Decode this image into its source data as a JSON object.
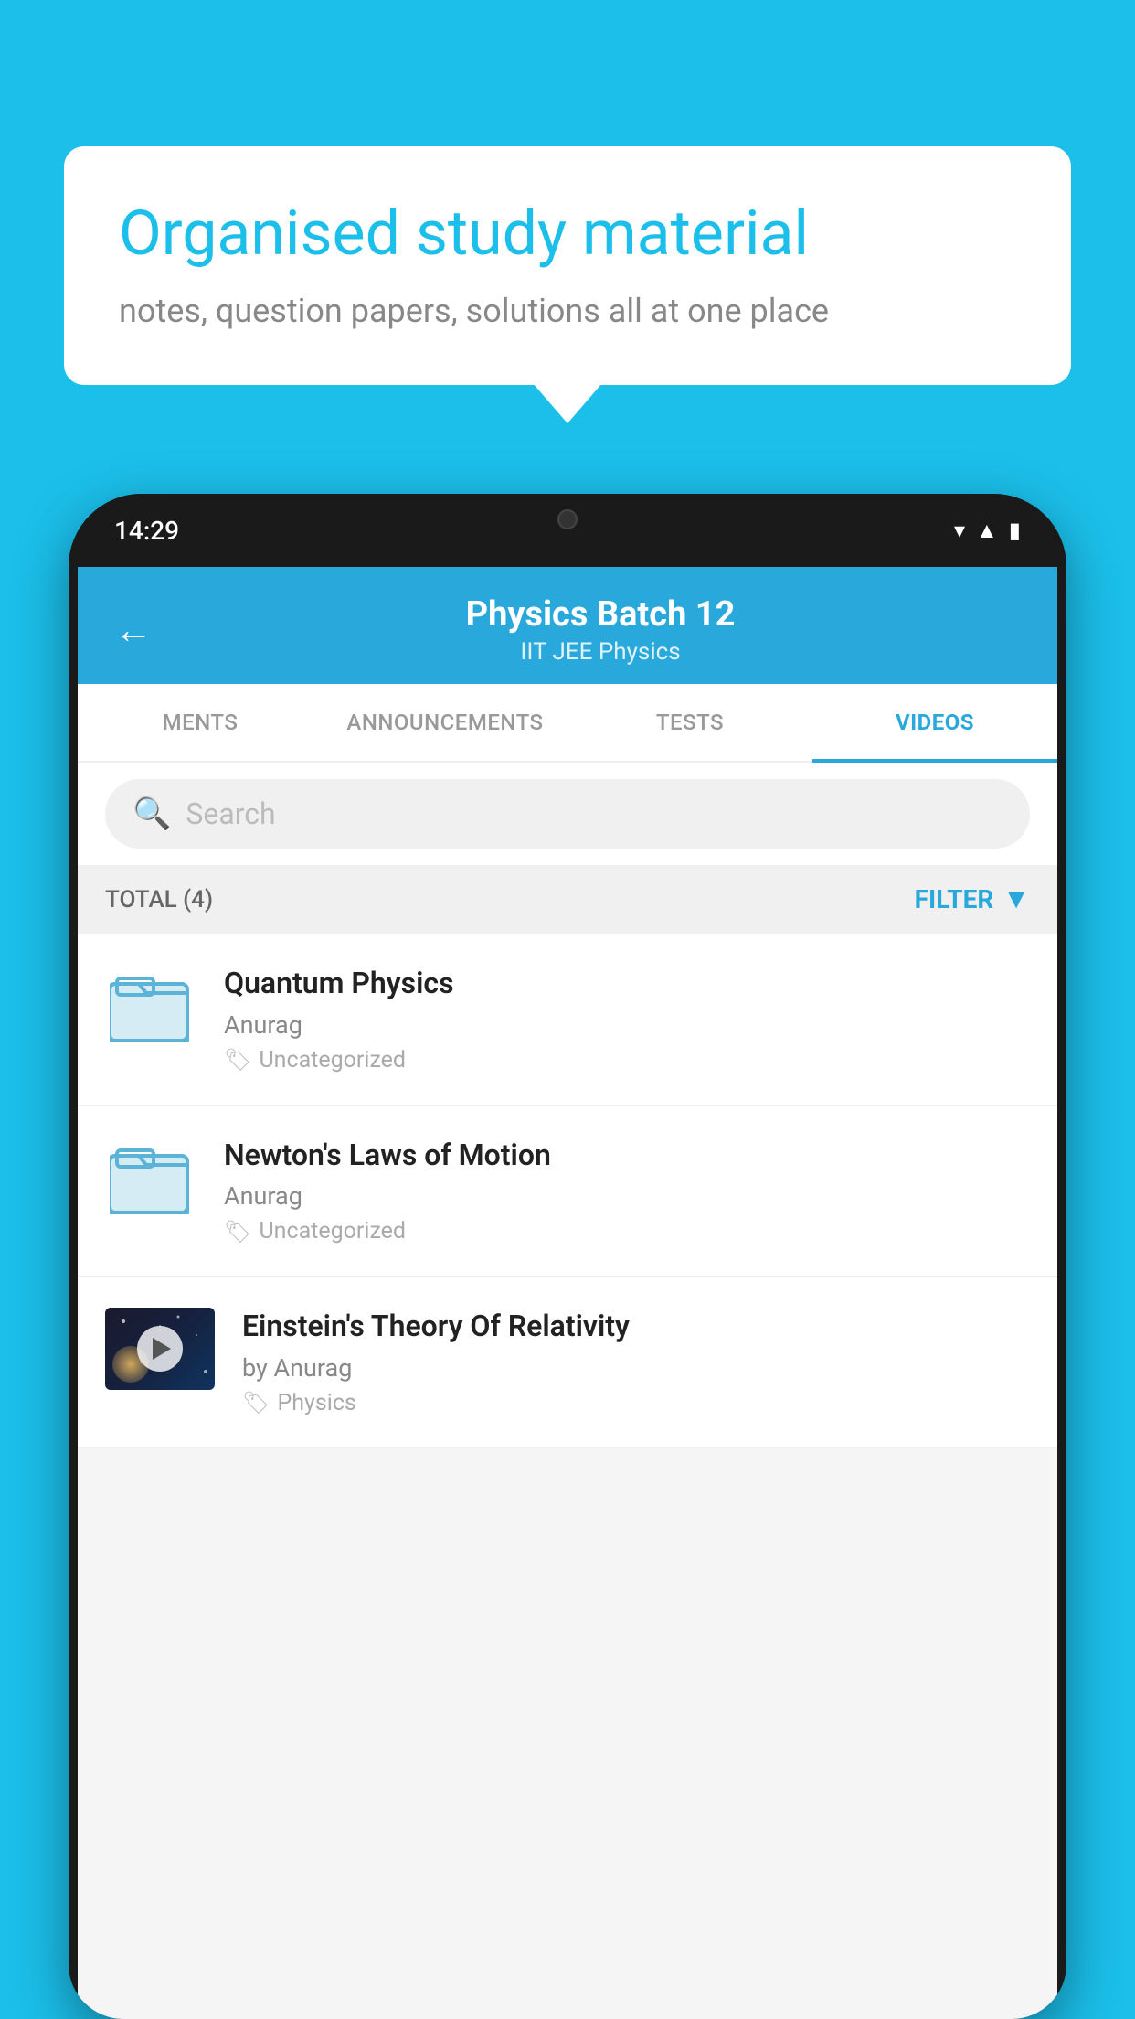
{
  "background_color": "#1BBFEA",
  "bubble": {
    "title": "Organised study material",
    "subtitle": "notes, question papers, solutions all at one place"
  },
  "phone": {
    "status_time": "14:29",
    "header": {
      "title": "Physics Batch 12",
      "subtitle": "IIT JEE   Physics",
      "back_label": "←"
    },
    "tabs": [
      {
        "label": "MENTS",
        "active": false
      },
      {
        "label": "ANNOUNCEMENTS",
        "active": false
      },
      {
        "label": "TESTS",
        "active": false
      },
      {
        "label": "VIDEOS",
        "active": true
      }
    ],
    "search": {
      "placeholder": "Search"
    },
    "filter": {
      "total_label": "TOTAL (4)",
      "filter_label": "FILTER"
    },
    "videos": [
      {
        "id": 1,
        "title": "Quantum Physics",
        "author": "Anurag",
        "tag": "Uncategorized",
        "has_thumb": false
      },
      {
        "id": 2,
        "title": "Newton's Laws of Motion",
        "author": "Anurag",
        "tag": "Uncategorized",
        "has_thumb": false
      },
      {
        "id": 3,
        "title": "Einstein's Theory Of Relativity",
        "author": "by Anurag",
        "tag": "Physics",
        "has_thumb": true
      }
    ]
  }
}
